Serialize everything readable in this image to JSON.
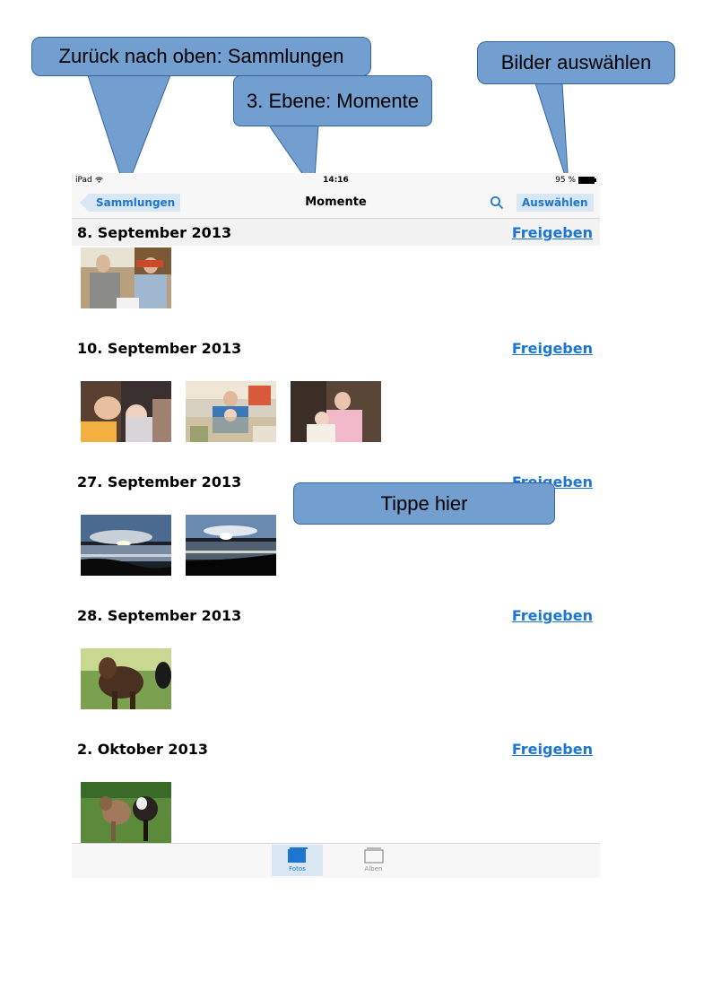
{
  "status_bar": {
    "carrier": "iPad",
    "time": "14:16",
    "battery": "95 %"
  },
  "nav_bar": {
    "back_label": "Sammlungen",
    "title": "Momente",
    "select_label": "Auswählen",
    "search_icon": "search-icon"
  },
  "moments": [
    {
      "date": "8. September 2013",
      "share_label": "Freigeben",
      "photos": [
        "couple-indoors"
      ]
    },
    {
      "date": "10. September 2013",
      "share_label": "Freigeben",
      "photos": [
        "grandparents-baby",
        "mother-baby-sofa",
        "grandmother-baby"
      ]
    },
    {
      "date": "27. September 2013",
      "share_label": "Freigeben",
      "photos": [
        "sunset-lake-1",
        "sunset-lake-2"
      ]
    },
    {
      "date": "28. September 2013",
      "share_label": "Freigeben",
      "photos": [
        "calf-in-grass"
      ]
    },
    {
      "date": "2. Oktober 2013",
      "share_label": "Freigeben",
      "photos": [
        "two-calves"
      ]
    }
  ],
  "tab_bar": {
    "tabs": [
      {
        "label": "Fotos",
        "icon": "photos-icon",
        "active": true
      },
      {
        "label": "Alben",
        "icon": "albums-icon",
        "active": false
      }
    ]
  },
  "callouts": {
    "back": "Zurück nach oben: Sammlungen",
    "level": "3. Ebene: Momente",
    "select": "Bilder auswählen",
    "tap": "Tippe hier"
  },
  "colors": {
    "accent": "#1d76d1",
    "callout_fill": "#729fcf",
    "callout_border": "#3465a4"
  }
}
